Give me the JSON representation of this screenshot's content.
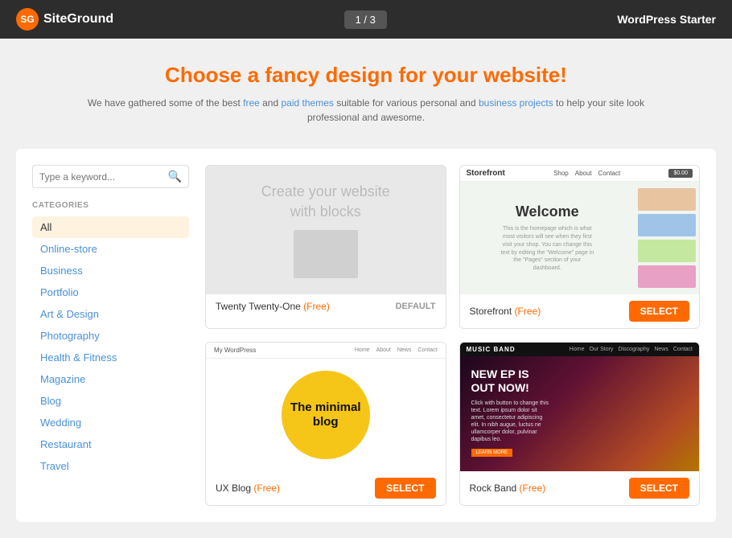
{
  "header": {
    "logo_text": "SiteGround",
    "pagination": "1 / 3",
    "plan": "WordPress Starter"
  },
  "hero": {
    "title": "Choose a fancy design for your website!",
    "subtitle": "We have gathered some of the best free and paid themes suitable for various personal and business projects to help your site look professional and awesome."
  },
  "sidebar": {
    "search_placeholder": "Type a keyword...",
    "categories_label": "CATEGORIES",
    "categories": [
      {
        "id": "all",
        "label": "All",
        "active": true
      },
      {
        "id": "online-store",
        "label": "Online-store",
        "active": false
      },
      {
        "id": "business",
        "label": "Business",
        "active": false
      },
      {
        "id": "portfolio",
        "label": "Portfolio",
        "active": false
      },
      {
        "id": "art-design",
        "label": "Art & Design",
        "active": false
      },
      {
        "id": "photography",
        "label": "Photography",
        "active": false
      },
      {
        "id": "health-fitness",
        "label": "Health & Fitness",
        "active": false
      },
      {
        "id": "magazine",
        "label": "Magazine",
        "active": false
      },
      {
        "id": "blog",
        "label": "Blog",
        "active": false
      },
      {
        "id": "wedding",
        "label": "Wedding",
        "active": false
      },
      {
        "id": "restaurant",
        "label": "Restaurant",
        "active": false
      },
      {
        "id": "travel",
        "label": "Travel",
        "active": false
      }
    ]
  },
  "themes": [
    {
      "id": "twenty-twenty-one",
      "name": "Twenty Twenty-One",
      "price_label": "Free",
      "is_default": true,
      "default_badge": "DEFAULT",
      "select_label": "SELECT",
      "preview_text_line1": "Create your website",
      "preview_text_line2": "with blocks"
    },
    {
      "id": "storefront",
      "name": "Storefront",
      "price_label": "Free",
      "is_default": false,
      "select_label": "SELECT",
      "sf_logo": "Storefront",
      "sf_nav": [
        "Shop",
        "About",
        "Contact"
      ],
      "sf_welcome": "Welcome",
      "sf_desc": "This is the homepage which is what most visitors will see when they first visit your shop."
    },
    {
      "id": "ux-blog",
      "name": "UX Blog",
      "price_label": "Free",
      "is_default": false,
      "select_label": "SELECT",
      "blog_title_line1": "The minimal",
      "blog_title_line2": "blog",
      "blog_site_name": "My WordPress"
    },
    {
      "id": "rock-band",
      "name": "Rock Band",
      "price_label": "Free",
      "is_default": false,
      "select_label": "SELECT",
      "rb_logo": "MUSIC BAND",
      "rb_nav": [
        "Home",
        "Our Story",
        "Discography",
        "News",
        "Contact"
      ],
      "rb_headline_line1": "NEW EP IS",
      "rb_headline_line2": "OUT NOW!",
      "rb_learn_more": "LEARN MORE"
    }
  ],
  "colors": {
    "accent": "#ff6a00",
    "link": "#4a90d9"
  }
}
